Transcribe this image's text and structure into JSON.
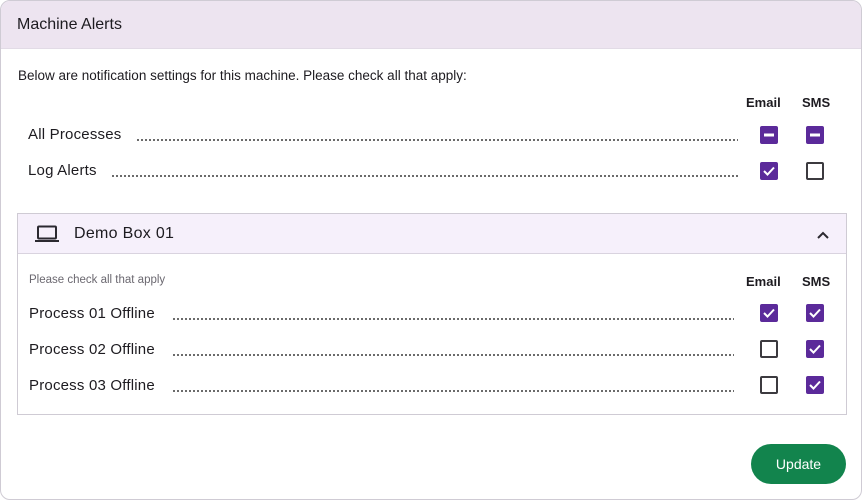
{
  "dialog": {
    "title": "Machine Alerts",
    "intro": "Below are notification settings for this machine. Please check all that apply:"
  },
  "columns": {
    "email": "Email",
    "sms": "SMS"
  },
  "global_rows": [
    {
      "label": "All Processes",
      "email": "indeterminate",
      "sms": "indeterminate"
    },
    {
      "label": "Log Alerts",
      "email": "checked",
      "sms": "unchecked"
    }
  ],
  "machine_panel": {
    "title": "Demo Box 01",
    "expanded": true,
    "hint": "Please check all that apply",
    "rows": [
      {
        "label": "Process 01 Offline",
        "email": "checked",
        "sms": "checked"
      },
      {
        "label": "Process 02 Offline",
        "email": "unchecked",
        "sms": "checked"
      },
      {
        "label": "Process 03 Offline",
        "email": "unchecked",
        "sms": "checked"
      }
    ]
  },
  "actions": {
    "update_label": "Update"
  },
  "colors": {
    "accent": "#5b2a9a",
    "header_bg": "#ede4f0",
    "panel_header_bg": "#f6f0fb",
    "button_bg": "#12844d"
  },
  "icons": {
    "panel": "laptop-icon",
    "toggle": "chevron-up-icon"
  }
}
